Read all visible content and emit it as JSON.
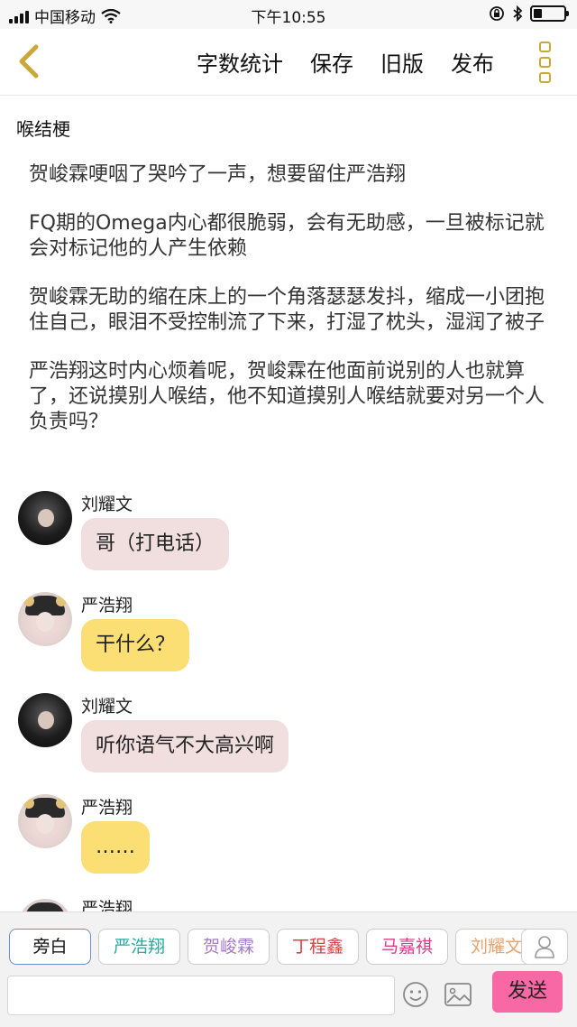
{
  "status_bar": {
    "carrier": "中国移动",
    "time": "下午10:55"
  },
  "header": {
    "actions": [
      "字数统计",
      "保存",
      "旧版",
      "发布"
    ],
    "icons": [
      "back-arrow-icon",
      "more-icon"
    ]
  },
  "doc": {
    "title": "喉结梗",
    "paragraphs": [
      "贺峻霖哽咽了哭吟了一声，想要留住严浩翔",
      "FQ期的Omega内心都很脆弱，会有无助感，一旦被标记就会对标记他的人产生依赖",
      "贺峻霖无助的缩在床上的一个角落瑟瑟发抖，缩成一小团抱住自己，眼泪不受控制流了下来，打湿了枕头，湿润了被子",
      "严浩翔这时内心烦着呢，贺峻霖在他面前说别的人也就算了，还说摸别人喉结，他不知道摸别人喉结就要对另一个人负责吗？"
    ]
  },
  "chat": [
    {
      "sender": "刘耀文",
      "text": "哥（打电话）",
      "style": "pink",
      "avatar": "dark"
    },
    {
      "sender": "严浩翔",
      "text": "干什么？",
      "style": "yellow",
      "avatar": "light"
    },
    {
      "sender": "刘耀文",
      "text": "听你语气不大高兴啊",
      "style": "pink",
      "avatar": "dark"
    },
    {
      "sender": "严浩翔",
      "text": "……",
      "style": "yellow",
      "avatar": "light"
    }
  ],
  "partial_sender": "严浩翔",
  "roles": [
    {
      "label": "旁白",
      "color": "#111111"
    },
    {
      "label": "严浩翔",
      "color": "#27a9a0"
    },
    {
      "label": "贺峻霖",
      "color": "#a779c8"
    },
    {
      "label": "丁程鑫",
      "color": "#d24545"
    },
    {
      "label": "马嘉祺",
      "color": "#d63d8a"
    },
    {
      "label": "刘耀文",
      "color": "#e6a36e"
    }
  ],
  "composer": {
    "value": "",
    "send_label": "发送"
  },
  "colors": {
    "accent": "#caa93a",
    "send": "#f768a4",
    "bubble_pink": "#f1dedf",
    "bubble_yellow": "#fbdf74"
  }
}
